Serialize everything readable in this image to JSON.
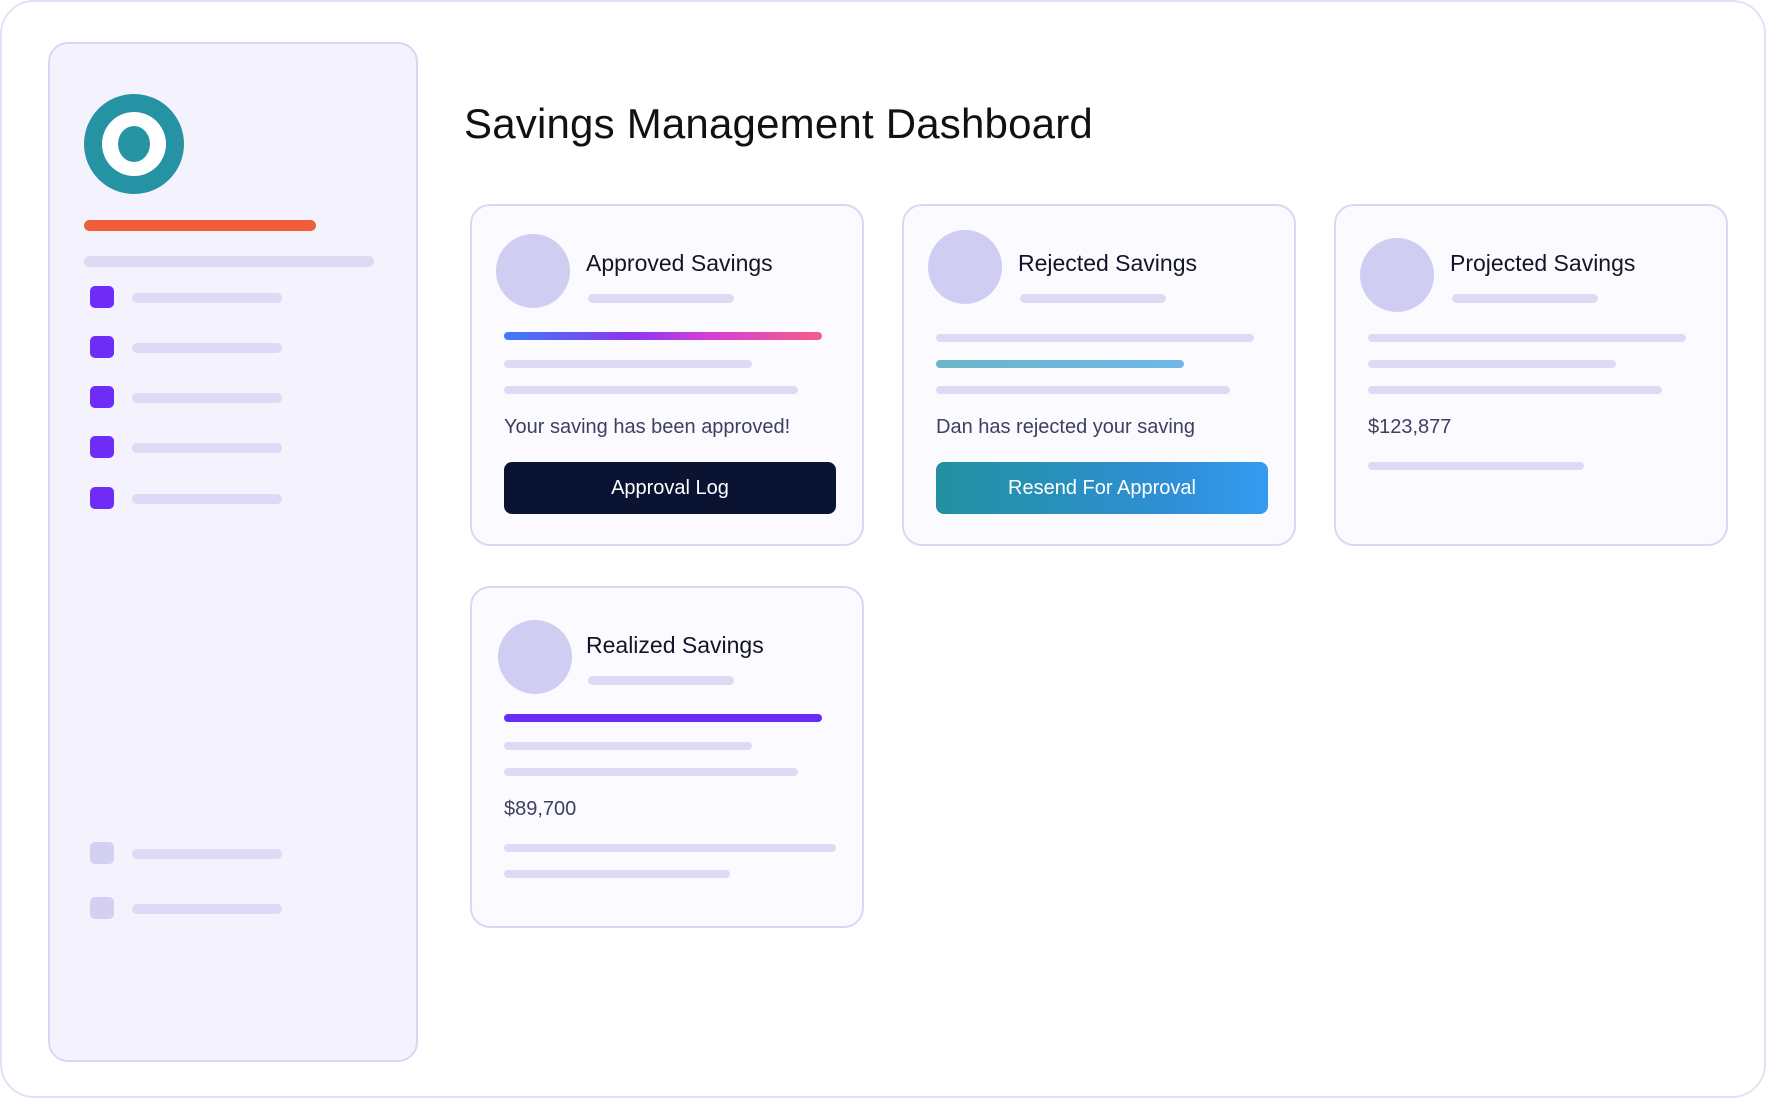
{
  "page": {
    "title": "Savings Management Dashboard"
  },
  "sidebar": {
    "logo_icon": "ring-logo-icon",
    "brand_color": "#f05d3b",
    "nav_icon_color": "#6f2cf6",
    "items": [
      {
        "icon": "nav-square-icon"
      },
      {
        "icon": "nav-square-icon"
      },
      {
        "icon": "nav-square-icon"
      },
      {
        "icon": "nav-square-icon"
      },
      {
        "icon": "nav-square-icon"
      }
    ],
    "bottom_items": [
      {
        "icon": "nav-square-icon"
      },
      {
        "icon": "nav-square-icon"
      }
    ]
  },
  "cards": {
    "approved": {
      "title": "Approved Savings",
      "message": "Your saving has been approved!",
      "button_label": "Approval Log",
      "button_color": "#0b1333"
    },
    "rejected": {
      "title": "Rejected Savings",
      "message": "Dan has rejected your saving",
      "button_label": "Resend For Approval",
      "button_color": "#22909f"
    },
    "projected": {
      "title": "Projected Savings",
      "amount": "$123,877"
    },
    "realized": {
      "title": "Realized Savings",
      "amount": "$89,700",
      "accent_color": "#6a2cf4"
    }
  }
}
